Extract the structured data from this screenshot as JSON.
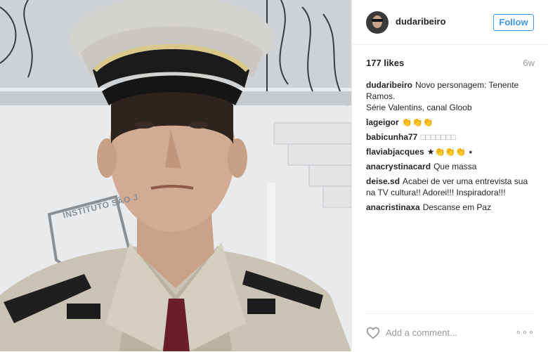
{
  "header": {
    "username": "dudaribeiro",
    "follow_label": "Follow"
  },
  "photo": {
    "emblem_text": "INSTITUTO SÃO J"
  },
  "stats": {
    "likes": "177 likes",
    "age": "6w"
  },
  "comments": [
    {
      "user": "dudaribeiro",
      "text": "Novo personagem: Tenente Ramos.\nSérie Valentins, canal Gloob"
    },
    {
      "user": "lageigor",
      "text": "👏👏👏"
    },
    {
      "user": "babicunha77",
      "text": "□□□□□□□"
    },
    {
      "user": "flaviabjacques",
      "text": "★👏👏👏 ⭑"
    },
    {
      "user": "anacrystinacard",
      "text": "Que massa"
    },
    {
      "user": "deise.sd",
      "text": "Acabei de ver uma entrevista sua na TV cultura!! Adorei!!! Inspiradora!!!"
    },
    {
      "user": "anacristinaxa",
      "text": "Descanse em Paz"
    }
  ],
  "footer": {
    "add_comment_placeholder": "Add a comment...",
    "more_label": "∘∘∘"
  },
  "icons": {
    "heart": "heart-icon",
    "more": "ellipsis-icon"
  }
}
